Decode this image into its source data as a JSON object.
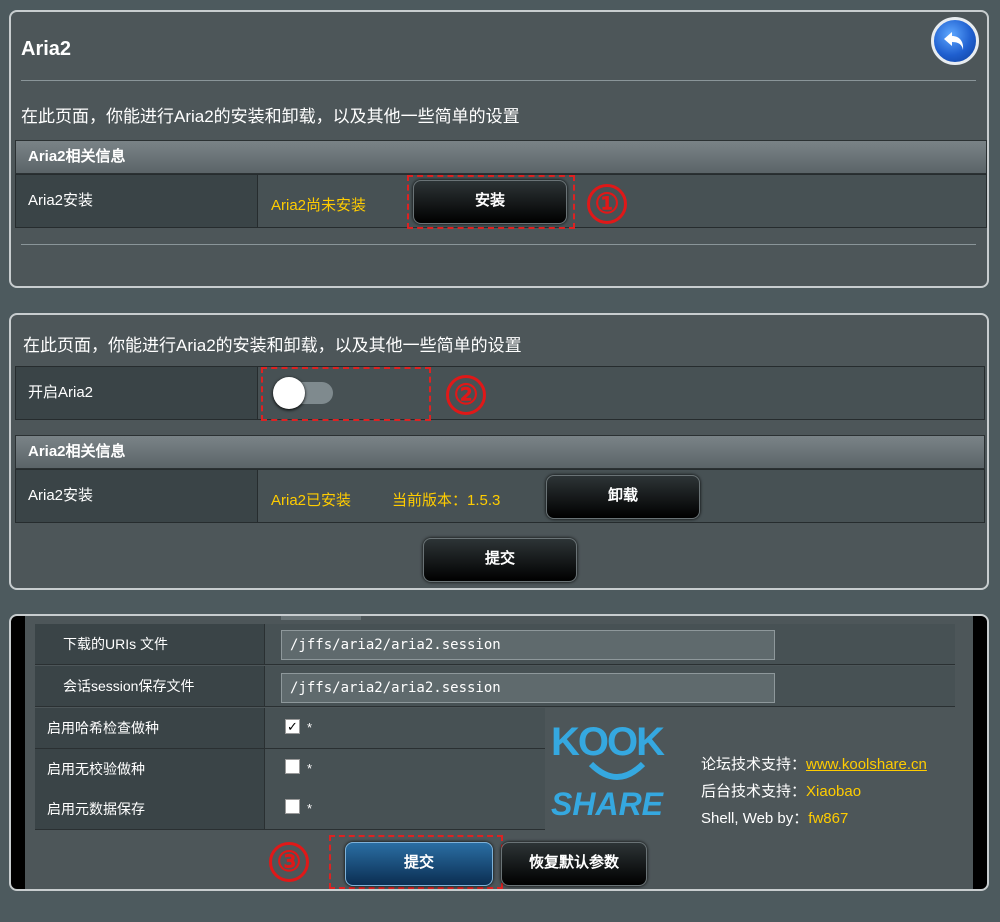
{
  "panel1": {
    "title": "Aria2",
    "description": "在此页面，你能进行Aria2的安装和卸载，以及其他一些简单的设置",
    "section_header": "Aria2相关信息",
    "install_label": "Aria2安装",
    "install_status": "Aria2尚未安装",
    "install_button": "安装",
    "marker": "①"
  },
  "panel2": {
    "description": "在此页面，你能进行Aria2的安装和卸载，以及其他一些简单的设置",
    "enable_label": "开启Aria2",
    "enable_toggle_on": false,
    "marker": "②",
    "section_header": "Aria2相关信息",
    "install_label": "Aria2安装",
    "install_status": "Aria2已安装",
    "version_text": "当前版本：1.5.3",
    "uninstall_button": "卸载",
    "submit_button": "提交"
  },
  "panel3": {
    "rows": [
      {
        "label": "下载的URIs 文件",
        "value": "/jffs/aria2/aria2.session"
      },
      {
        "label": "会话session保存文件",
        "value": "/jffs/aria2/aria2.session"
      }
    ],
    "checks": [
      {
        "label": "启用哈希检查做种",
        "checked": true,
        "mark": "*"
      },
      {
        "label": "启用无校验做种",
        "checked": false,
        "mark": "*"
      },
      {
        "label": "启用元数据保存",
        "checked": false,
        "mark": "*"
      }
    ],
    "logo_top": "KOOK",
    "logo_bottom": "SHARE",
    "credits": [
      {
        "label": "论坛技术支持：",
        "value": "www.koolshare.cn"
      },
      {
        "label": "后台技术支持：",
        "value": "Xiaobao"
      },
      {
        "label": "Shell, Web by：",
        "value": "fw867"
      }
    ],
    "marker": "③",
    "submit_button": "提交",
    "restore_button": "恢复默认参数",
    "colors": {
      "accent": "#ffcc00",
      "logo": "#35a8e0",
      "marker": "#e01818"
    }
  }
}
